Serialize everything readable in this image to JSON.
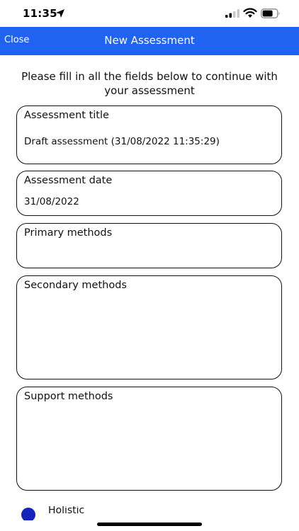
{
  "status_bar": {
    "time": "11:35"
  },
  "nav": {
    "close_label": "Close",
    "title": "New Assessment"
  },
  "intro_text": "Please fill in all the fields below to continue with your assessment",
  "fields": {
    "title": {
      "label": "Assessment title",
      "value": "Draft assessment (31/08/2022 11:35:29)"
    },
    "date": {
      "label": "Assessment date",
      "value": "31/08/2022"
    },
    "primary": {
      "label": "Primary methods",
      "value": ""
    },
    "secondary": {
      "label": "Secondary methods",
      "value": ""
    },
    "support": {
      "label": "Support methods",
      "value": ""
    }
  },
  "holistic": {
    "label": "Holistic"
  },
  "colors": {
    "nav_bar": "#1f63f0",
    "radio": "#1423b8"
  }
}
